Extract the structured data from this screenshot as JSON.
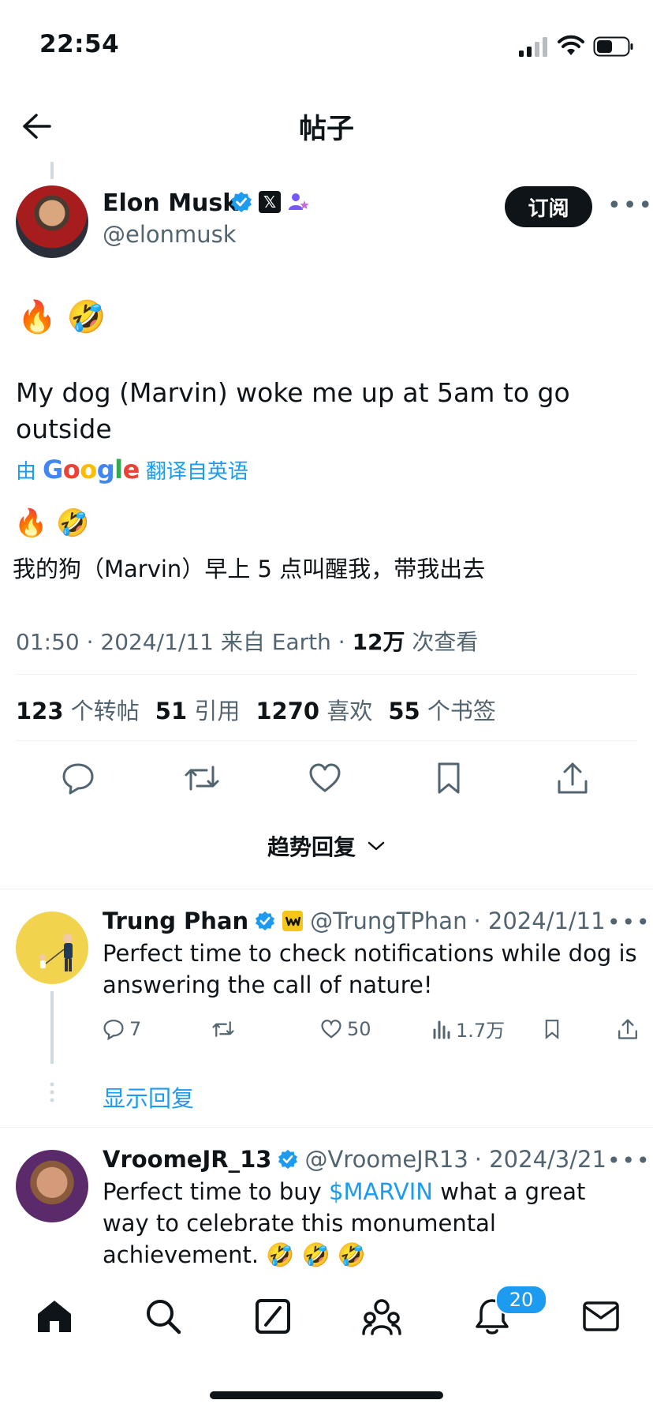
{
  "status_bar": {
    "time": "22:54"
  },
  "header": {
    "title": "帖子"
  },
  "post": {
    "author_name": "Elon Musk",
    "author_handle": "@elonmusk",
    "subscribe_label": "订阅",
    "emoji_line": "🔥 🤣",
    "text": "My dog (Marvin) woke me up at 5am to go outside",
    "translate_prefix": "由",
    "translate_brand": "Google",
    "translate_suffix": "翻译自英语",
    "translated_emoji": "🔥 🤣",
    "translated_text": "我的狗（Marvin）早上 5 点叫醒我，带我出去",
    "meta_time": "01:50 · 2024/1/11 来自 Earth · ",
    "views_num": "12万",
    "views_label": " 次查看",
    "stats": [
      {
        "num": "123",
        "label": "个转帖"
      },
      {
        "num": "51",
        "label": "引用"
      },
      {
        "num": "1270",
        "label": "喜欢"
      },
      {
        "num": "55",
        "label": "个书签"
      }
    ]
  },
  "sort": {
    "label": "趋势回复"
  },
  "replies": [
    {
      "name": "Trung Phan",
      "handle": "@TrungTPhan",
      "date": "· 2024/1/11",
      "text": "Perfect time to check notifications while dog is answering the call of nature!",
      "replies": "7",
      "likes": "50",
      "views": "1.7万",
      "show_replies": "显示回复"
    },
    {
      "name": "VroomeJR_13",
      "handle": "@VroomeJR13",
      "date": "· 2024/3/21",
      "text_before": "Perfect time to buy ",
      "cashtag": "$MARVIN",
      "text_after": " what a great way to celebrate this monumental achievement. 🤣 🤣 🤣"
    }
  ],
  "tabbar": {
    "notification_count": "20"
  },
  "colors": {
    "accent": "#1d9bf0",
    "text": "#0f1419",
    "muted": "#536471"
  }
}
